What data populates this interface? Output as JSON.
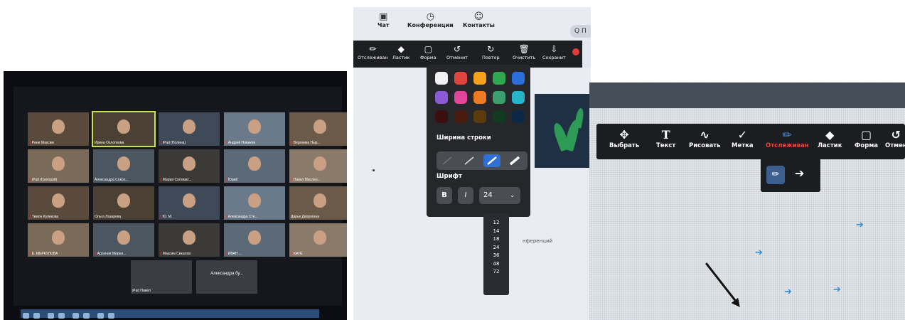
{
  "gallery": {
    "participants": [
      {
        "name": "Рини Максим",
        "muted": true
      },
      {
        "name": "Ирина Охлопкова",
        "muted": false,
        "highlighted": true
      },
      {
        "name": "iPad (Полина)",
        "muted": true
      },
      {
        "name": "Андрей Новиков",
        "muted": true
      },
      {
        "name": "Вероника Ныр...",
        "muted": true
      },
      {
        "name": "iPad (Григорий)",
        "muted": true
      },
      {
        "name": "Александра Сокол...",
        "muted": false
      },
      {
        "name": "Мария Соломат...",
        "muted": true
      },
      {
        "name": "Юрий",
        "muted": true
      },
      {
        "name": "Павел Маслен...",
        "muted": true
      },
      {
        "name": "Тимон Куликова",
        "muted": true
      },
      {
        "name": "Ольга Лазарева",
        "muted": false
      },
      {
        "name": "Ю. М.",
        "muted": true
      },
      {
        "name": "Александра Сте...",
        "muted": true
      },
      {
        "name": "Дарья Дворягина",
        "muted": false
      },
      {
        "name": "Е. МЕРКУЛОВА",
        "muted": true
      },
      {
        "name": "Арсения Мерен...",
        "muted": true
      },
      {
        "name": "Максим Сикалов",
        "muted": true
      },
      {
        "name": "ИВАН ...",
        "muted": true
      },
      {
        "name": "KATE",
        "muted": true
      }
    ],
    "name_only_tiles": [
      {
        "name": "iPad Павел"
      },
      {
        "center": "Александра бу...",
        "name": ""
      }
    ]
  },
  "zoom_app": {
    "nav": {
      "chat": "Чат",
      "conferences": "Конференции",
      "contacts": "Контакты",
      "search": "Q П"
    },
    "annotate_toolbar": {
      "tracking": "Отслеживан",
      "eraser": "Ластик",
      "shape": "Форма",
      "undo": "Отменит",
      "redo": "Повтор",
      "clear": "Очистить",
      "save": "Сохранит"
    },
    "popup": {
      "colors": [
        "#f2f2f2",
        "#e0443e",
        "#f4a21b",
        "#2fa84f",
        "#2a6fdb",
        "#8b5bd6",
        "#e2459c",
        "#f07a22",
        "#3aa06e",
        "#27b3c9",
        "#3a0f10",
        "#4a1c10",
        "#5a3c0c",
        "#123a1e",
        "#0d2747"
      ],
      "line_width_label": "Ширина строки",
      "font_label": "Шрифт",
      "bold": "B",
      "italic": "I",
      "font_size": "24",
      "sizes": [
        "12",
        "14",
        "18",
        "24",
        "36",
        "48",
        "72"
      ]
    },
    "background_text": "нференций"
  },
  "whiteboard": {
    "tools": {
      "select": "Выбрать",
      "text": "Текст",
      "draw": "Рисовать",
      "stamp": "Метка",
      "tracking": "Отслеживан",
      "eraser": "Ластик",
      "shape": "Форма",
      "undo": "Отмен"
    },
    "accent_color": "#e04a3a"
  }
}
